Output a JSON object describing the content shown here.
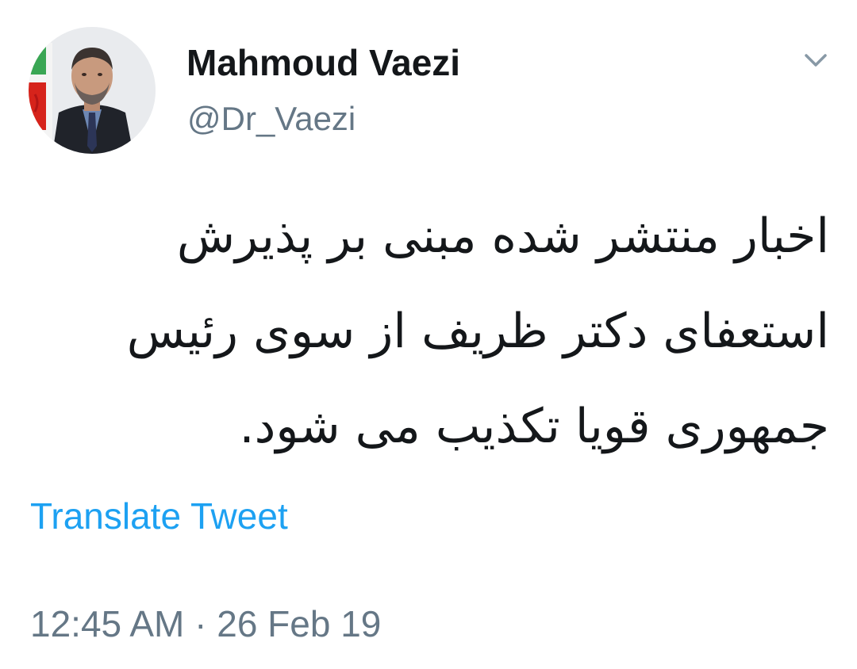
{
  "tweet": {
    "author_name": "Mahmoud Vaezi",
    "author_handle": "@Dr_Vaezi",
    "text": "اخبار منتشر شده مبنی بر پذیرش استعفای دکتر ظریف از سوی رئیس جمهوری قویا تکذیب می شود.",
    "translate_label": "Translate Tweet",
    "timestamp": "12:45 AM · 26 Feb 19"
  },
  "icons": {
    "more": "chevron-down-icon"
  },
  "colors": {
    "primary_text": "#14171a",
    "secondary_text": "#657786",
    "link": "#1da1f2",
    "background": "#ffffff"
  }
}
